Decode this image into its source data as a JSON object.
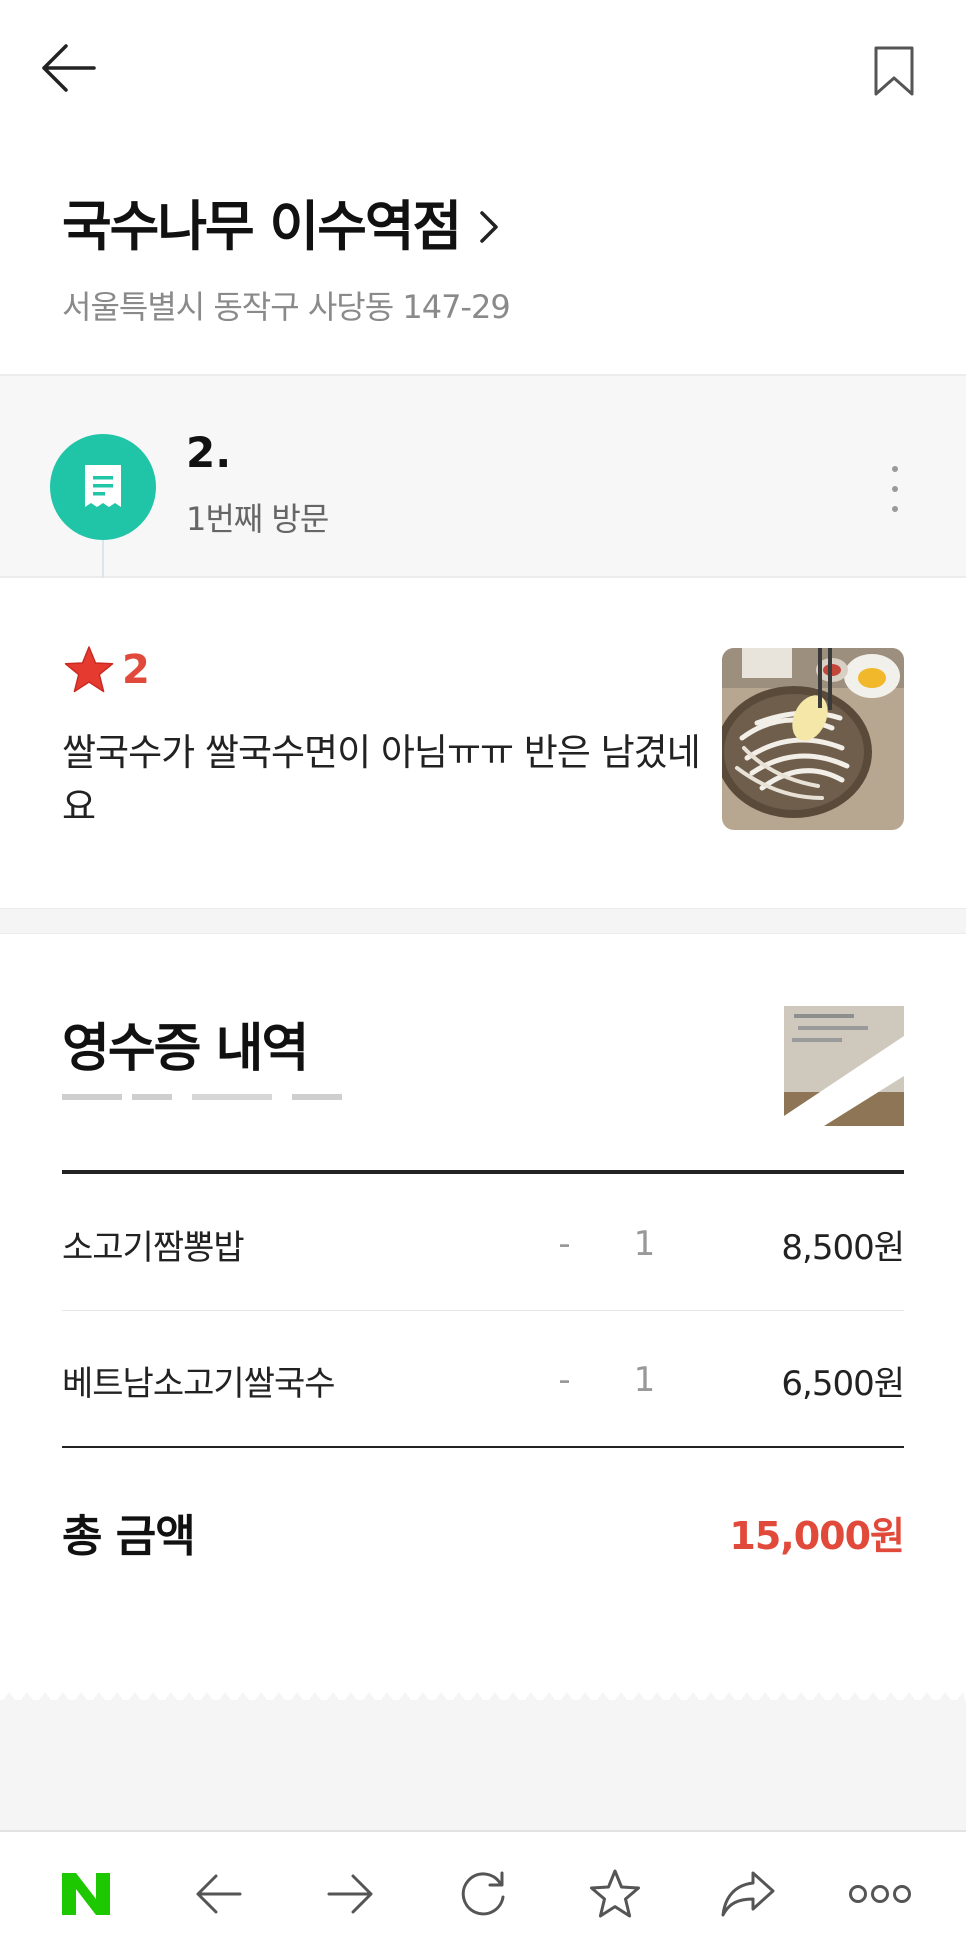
{
  "place": {
    "name": "국수나무 이수역점",
    "address": "서울특별시 동작구 사당동 147-29"
  },
  "visit": {
    "user_name": "2.",
    "visit_count": "1번째 방문"
  },
  "review": {
    "rating": 2,
    "rating_text": "2",
    "text": "쌀국수가 쌀국수면이 아님ㅠㅠ 반은 남겼네요"
  },
  "receipt": {
    "title": "영수증 내역",
    "items": [
      {
        "name": "소고기짬뽕밥",
        "option": "-",
        "qty": "1",
        "price": "8,500원"
      },
      {
        "name": "베트남소고기쌀국수",
        "option": "-",
        "qty": "1",
        "price": "6,500원"
      }
    ],
    "total_label": "총 금액",
    "total_value": "15,000원"
  },
  "colors": {
    "accent_red": "#e14a3b",
    "receipt_green": "#20c5a7",
    "naver_green": "#1ec800"
  },
  "icons": {
    "top_left": "back-arrow-icon",
    "top_right": "bookmark-icon",
    "bottom_bar": [
      "naver-logo-icon",
      "back-icon",
      "forward-icon",
      "refresh-icon",
      "star-icon",
      "share-icon",
      "more-icon"
    ]
  }
}
